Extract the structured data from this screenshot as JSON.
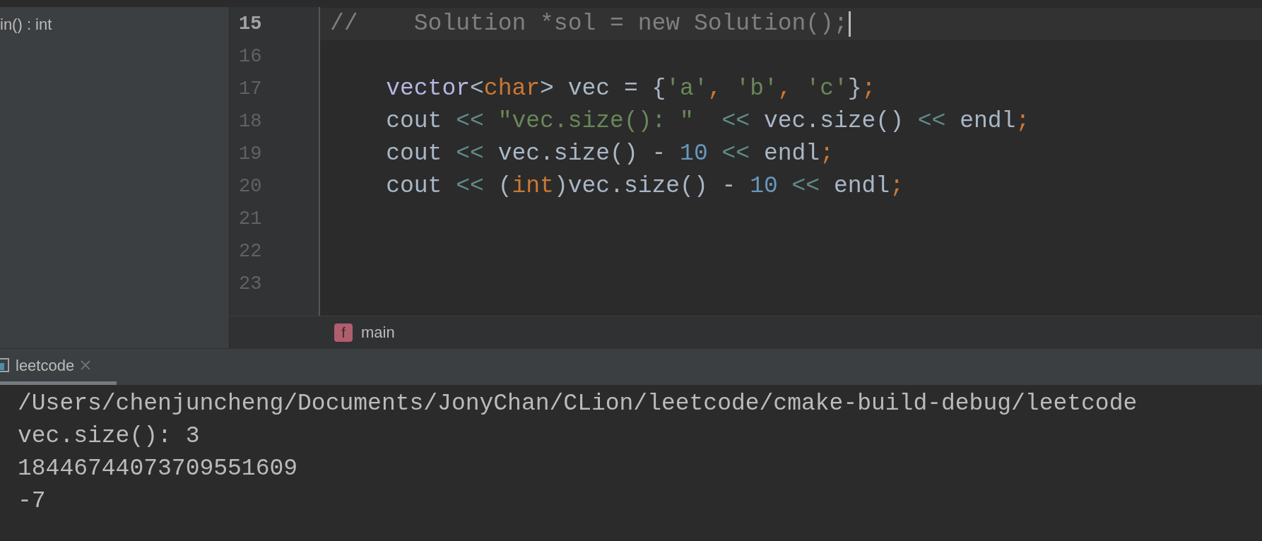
{
  "structure": {
    "item": "in() : int"
  },
  "editor": {
    "lines": [
      {
        "number": "15",
        "current": true,
        "tokens": [
          {
            "text": "//    Solution *sol = new Solution();",
            "kind": "comment"
          }
        ]
      },
      {
        "number": "16",
        "current": false
      },
      {
        "number": "17",
        "current": false,
        "tokens": [
          {
            "text": "    vector",
            "kind": "type"
          },
          {
            "text": "<",
            "kind": "plain"
          },
          {
            "text": "char",
            "kind": "keyword"
          },
          {
            "text": "> vec = {",
            "kind": "plain"
          },
          {
            "text": "'a'",
            "kind": "string"
          },
          {
            "text": ",",
            "kind": "punct"
          },
          {
            "text": " 'b'",
            "kind": "string"
          },
          {
            "text": ",",
            "kind": "punct"
          },
          {
            "text": " 'c'",
            "kind": "string"
          },
          {
            "text": "}",
            "kind": "plain"
          },
          {
            "text": ";",
            "kind": "punct"
          }
        ]
      },
      {
        "number": "18",
        "current": false,
        "tokens": [
          {
            "text": "    cout ",
            "kind": "plain"
          },
          {
            "text": "<<",
            "kind": "operator"
          },
          {
            "text": " \"vec.size(): \"  ",
            "kind": "string"
          },
          {
            "text": "<<",
            "kind": "operator"
          },
          {
            "text": " vec.size() ",
            "kind": "plain"
          },
          {
            "text": "<<",
            "kind": "operator"
          },
          {
            "text": " endl",
            "kind": "plain"
          },
          {
            "text": ";",
            "kind": "punct"
          }
        ]
      },
      {
        "number": "19",
        "current": false,
        "tokens": [
          {
            "text": "    cout ",
            "kind": "plain"
          },
          {
            "text": "<<",
            "kind": "operator"
          },
          {
            "text": " vec.size() - ",
            "kind": "plain"
          },
          {
            "text": "10 ",
            "kind": "number"
          },
          {
            "text": "<<",
            "kind": "operator"
          },
          {
            "text": " endl",
            "kind": "plain"
          },
          {
            "text": ";",
            "kind": "punct"
          }
        ]
      },
      {
        "number": "20",
        "current": false,
        "tokens": [
          {
            "text": "    cout ",
            "kind": "plain"
          },
          {
            "text": "<<",
            "kind": "operator"
          },
          {
            "text": " (",
            "kind": "plain"
          },
          {
            "text": "int",
            "kind": "keyword"
          },
          {
            "text": ")vec.size() - ",
            "kind": "plain"
          },
          {
            "text": "10 ",
            "kind": "number"
          },
          {
            "text": "<<",
            "kind": "operator"
          },
          {
            "text": " endl",
            "kind": "plain"
          },
          {
            "text": ";",
            "kind": "punct"
          }
        ]
      },
      {
        "number": "21",
        "current": false
      },
      {
        "number": "22",
        "current": false
      },
      {
        "number": "23",
        "current": false
      }
    ]
  },
  "breadcrumb": {
    "icon": "f",
    "label": "main"
  },
  "run_tabs": [
    {
      "label": "leetcode",
      "selected": true
    }
  ],
  "console": {
    "lines": [
      "/Users/chenjuncheng/Documents/JonyChan/CLion/leetcode/cmake-build-debug/leetcode",
      "vec.size(): 3",
      "18446744073709551609",
      "-7"
    ]
  }
}
